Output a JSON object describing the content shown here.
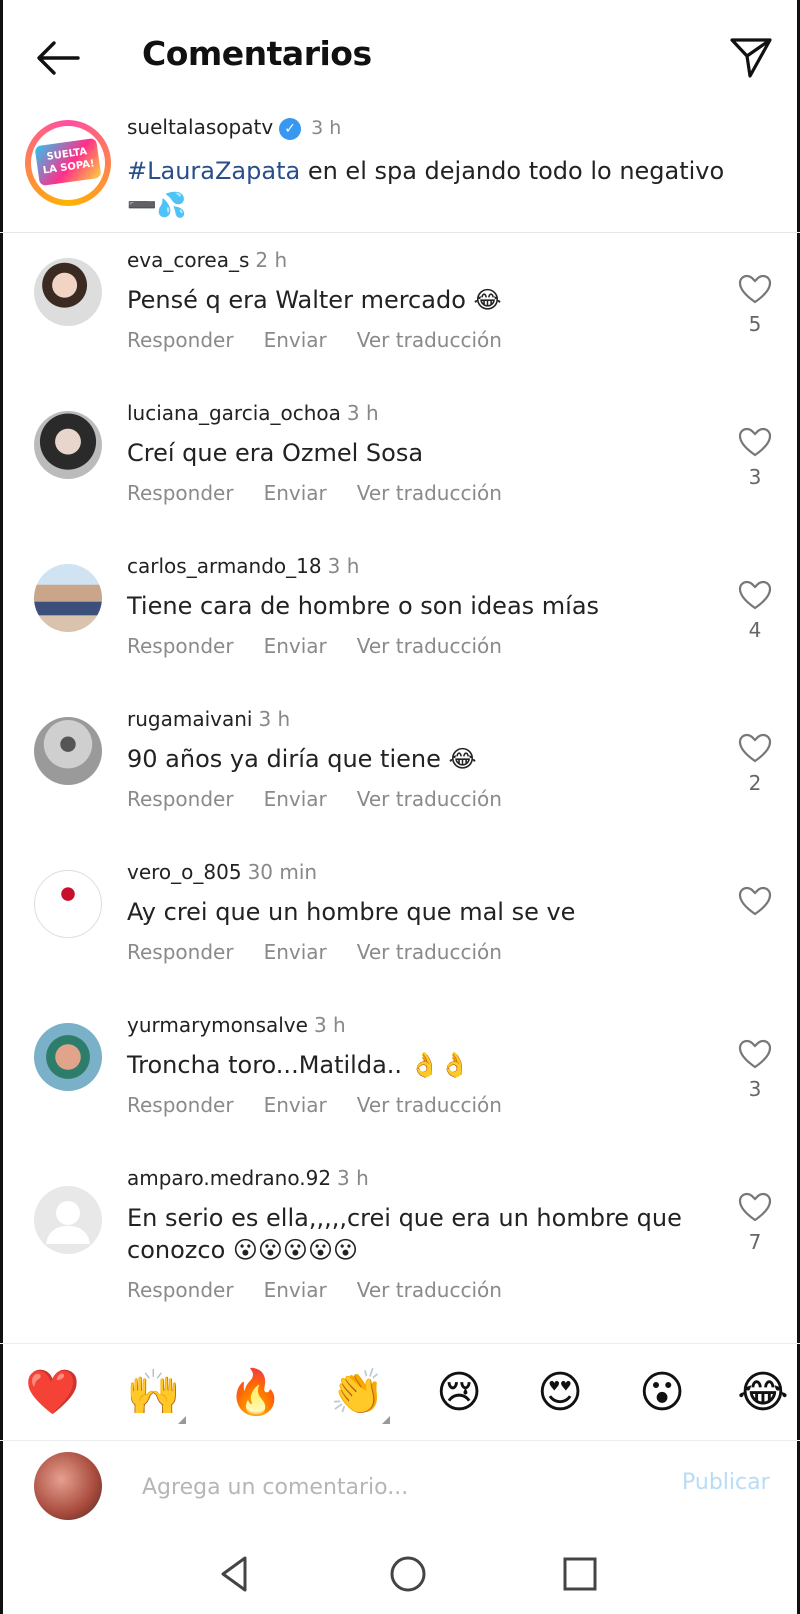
{
  "header": {
    "title": "Comentarios"
  },
  "caption": {
    "username": "sueltalasopatv",
    "time": "3 h",
    "hashtag": "#LauraZapata",
    "text": " en el spa dejando todo lo negativo",
    "logo_text_1": "SUELTA",
    "logo_text_2": "LA SOPA!"
  },
  "comments": [
    {
      "username": "eva_corea_s",
      "time": "2 h",
      "text": "Pensé q era Walter mercado 😂",
      "likes": "5"
    },
    {
      "username": "luciana_garcia_ochoa",
      "time": "3 h",
      "text": "Creí que era Ozmel Sosa",
      "likes": "3"
    },
    {
      "username": "carlos_armando_18",
      "time": "3 h",
      "text": "Tiene cara de hombre o son ideas mías",
      "likes": "4"
    },
    {
      "username": "rugamaivani",
      "time": "3 h",
      "text": "90 años ya diría  que tiene 😂",
      "likes": "2"
    },
    {
      "username": "vero_o_805",
      "time": "30 min",
      "text": "Ay crei que un hombre que mal se ve",
      "likes": ""
    },
    {
      "username": "yurmarymonsalve",
      "time": "3 h",
      "text": "Troncha toro...Matilda.. 👌👌",
      "likes": "3"
    },
    {
      "username": "amparo.medrano.92",
      "time": "3 h",
      "text": "En serio es ella,,,,,crei que era un hombre que conozco 😮😮😮😮😮",
      "likes": "7"
    }
  ],
  "actions": {
    "reply": "Responder",
    "send": "Enviar",
    "translate": "Ver traducción"
  },
  "emojis": [
    "❤️",
    "🙌",
    "🔥",
    "👏",
    "😢",
    "😍",
    "😮",
    "😂"
  ],
  "composer": {
    "placeholder": "Agrega un comentario...",
    "publish": "Publicar"
  },
  "colors": {
    "link": "#2a4e89",
    "verified": "#3897f0",
    "publish_disabled": "#b7dcf5"
  }
}
